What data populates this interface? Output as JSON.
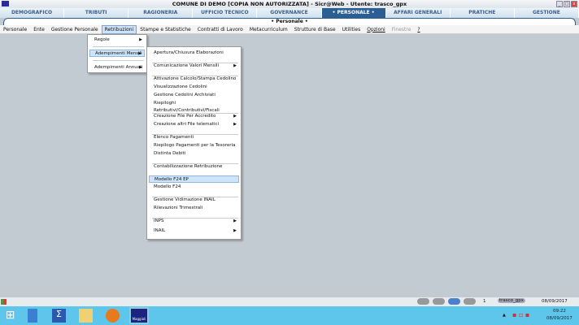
{
  "title": "COMUNE DI DEMO  [COPIA NON AUTORIZZATA]  -  Sicr@Web  -  Utente: trasco_gpx",
  "tabs": [
    "DEMOGRAFICO",
    "TRIBUTI",
    "RAGIONERIA",
    "UFFICIO TECNICO",
    "GOVERNANCE",
    "• PERSONALE •",
    "AFFARI GENERALI",
    "PRATICHE",
    "GESTIONE"
  ],
  "section_title": "• Personale •",
  "menubar": [
    "Personale",
    "Ente",
    "Gestione Personale",
    "Retribuzioni",
    "Stampe e Statistiche",
    "Contratti di Lavoro",
    "Metacurriculum",
    "Strutture di Base",
    "Utilities",
    "Opzioni",
    "Finestre",
    "?"
  ],
  "retribuzioni_menu": [
    "Regole",
    "Adempimenti Mensili",
    "Adempimenti Annuali"
  ],
  "submenu": [
    "Apertura/Chiusura Elaborazioni",
    "Comunicazione Valori Mensili",
    "Attivazione Calcolo/Stampa Cedolino",
    "Visualizzazione Cedolini",
    "Gestione Cedolini Archiviati",
    "Riepiloghi Retributivi/Contributivi/Fiscali",
    "Creazione File Per Accredito",
    "Creazione altri File telematici",
    "Elenco Pagamenti",
    "Riepilogo Pagamenti per la Tesoreria",
    "Distinta Debiti",
    "Contabilizzazione Retribuzione",
    "Modello F24 EP",
    "Modello F24",
    "Gestione Vidimazione INAIL",
    "Rilevazioni Trimestrali",
    "INPS",
    "INAIL"
  ],
  "status": {
    "count": "1",
    "user": "trasco_gpx",
    "date": "08/09/2017"
  },
  "clock": {
    "time": "09:22",
    "date": "08/09/2017"
  },
  "taskbar_app_label": "Maggioli"
}
